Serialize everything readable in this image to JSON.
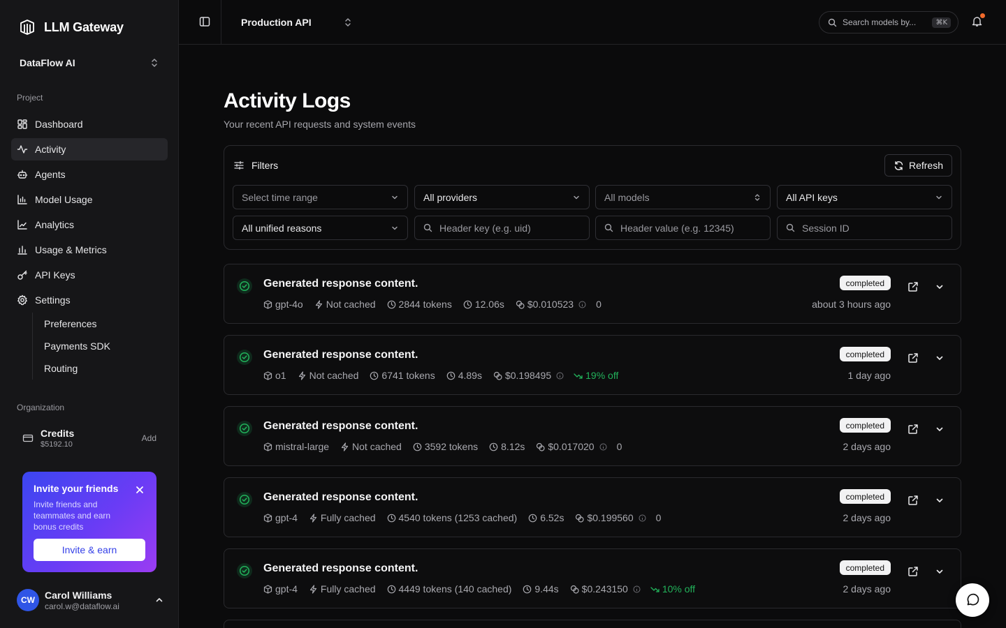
{
  "app": {
    "name": "LLM Gateway"
  },
  "org": {
    "name": "DataFlow AI"
  },
  "sidebar": {
    "project_label": "Project",
    "items": [
      {
        "label": "Dashboard",
        "icon": "dashboard-icon"
      },
      {
        "label": "Activity",
        "icon": "activity-icon",
        "active": true
      },
      {
        "label": "Agents",
        "icon": "bot-icon"
      },
      {
        "label": "Model Usage",
        "icon": "bar-chart-icon"
      },
      {
        "label": "Analytics",
        "icon": "line-chart-icon"
      },
      {
        "label": "Usage & Metrics",
        "icon": "bar-chart-icon"
      },
      {
        "label": "API Keys",
        "icon": "key-icon"
      },
      {
        "label": "Settings",
        "icon": "gear-icon"
      }
    ],
    "sub_items": [
      {
        "label": "Preferences"
      },
      {
        "label": "Payments SDK"
      },
      {
        "label": "Routing"
      }
    ],
    "org_label": "Organization",
    "credits": {
      "title": "Credits",
      "amount": "$5192.10",
      "add_label": "Add"
    },
    "invite": {
      "title": "Invite your friends",
      "description": "Invite friends and teammates and earn bonus credits",
      "button": "Invite & earn"
    },
    "user": {
      "initials": "CW",
      "name": "Carol Williams",
      "email": "carol.w@dataflow.ai"
    }
  },
  "topbar": {
    "project": "Production API",
    "search_placeholder": "Search models by...",
    "search_shortcut": "⌘K"
  },
  "page": {
    "title": "Activity Logs",
    "subtitle": "Your recent API requests and system events"
  },
  "filters": {
    "title": "Filters",
    "refresh_label": "Refresh",
    "time_range": "Select time range",
    "providers": "All providers",
    "models": "All models",
    "api_keys": "All API keys",
    "unified_reasons": "All unified reasons",
    "header_key_placeholder": "Header key (e.g. uid)",
    "header_value_placeholder": "Header value (e.g. 12345)",
    "session_placeholder": "Session ID"
  },
  "logs": [
    {
      "title": "Generated response content.",
      "model": "gpt-4o",
      "cache": "Not cached",
      "tokens": "2844 tokens",
      "duration": "12.06s",
      "cost": "$0.010523",
      "extra": "0",
      "extra_type": "plain",
      "status": "completed",
      "time": "about 3 hours ago"
    },
    {
      "title": "Generated response content.",
      "model": "o1",
      "cache": "Not cached",
      "tokens": "6741 tokens",
      "duration": "4.89s",
      "cost": "$0.198495",
      "extra": "19% off",
      "extra_type": "discount",
      "status": "completed",
      "time": "1 day ago"
    },
    {
      "title": "Generated response content.",
      "model": "mistral-large",
      "cache": "Not cached",
      "tokens": "3592 tokens",
      "duration": "8.12s",
      "cost": "$0.017020",
      "extra": "0",
      "extra_type": "plain",
      "status": "completed",
      "time": "2 days ago"
    },
    {
      "title": "Generated response content.",
      "model": "gpt-4",
      "cache": "Fully cached",
      "tokens": "4540 tokens (1253 cached)",
      "duration": "6.52s",
      "cost": "$0.199560",
      "extra": "0",
      "extra_type": "plain",
      "status": "completed",
      "time": "2 days ago"
    },
    {
      "title": "Generated response content.",
      "model": "gpt-4",
      "cache": "Fully cached",
      "tokens": "4449 tokens (140 cached)",
      "duration": "9.44s",
      "cost": "$0.243150",
      "extra": "10% off",
      "extra_type": "discount",
      "status": "completed",
      "time": "2 days ago"
    }
  ],
  "colors": {
    "accent": "#2f55e6",
    "success": "#22b35b",
    "notification": "#f26a2b"
  }
}
